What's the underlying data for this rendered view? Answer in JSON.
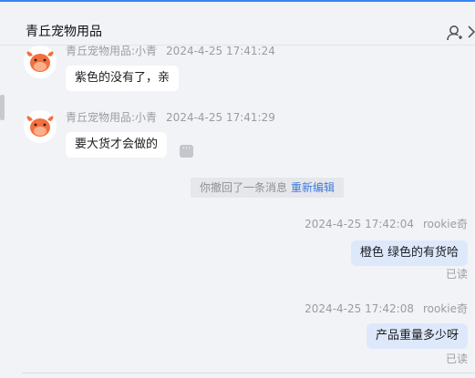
{
  "header": {
    "shop_title": "青丘宠物用品"
  },
  "messages_in": [
    {
      "sender": "青丘宠物用品:小青",
      "time": "2024-4-25 17:41:24",
      "text": "紫色的没有了，亲"
    },
    {
      "sender": "青丘宠物用品:小青",
      "time": "2024-4-25 17:41:29",
      "text": "要大货才会做的"
    }
  ],
  "recall": {
    "text": "你撤回了一条消息",
    "edit_label": "重新编辑"
  },
  "messages_out": [
    {
      "time": "2024-4-25 17:42:04",
      "sender": "rookie奇",
      "text": "橙色 绿色的有货哈",
      "status": "已读"
    },
    {
      "time": "2024-4-25 17:42:08",
      "sender": "rookie奇",
      "text": "产品重量多少呀",
      "status": "已读"
    }
  ],
  "icons": {
    "user": "user-icon",
    "chevron": "chevron-right-icon",
    "avatar": "cow-avatar-icon",
    "more": "more-icon"
  },
  "colors": {
    "accent": "#3a82f6",
    "link": "#3a7be0",
    "outgoing_bubble": "#dde8fb",
    "avatar_orange": "#f36f3e"
  }
}
